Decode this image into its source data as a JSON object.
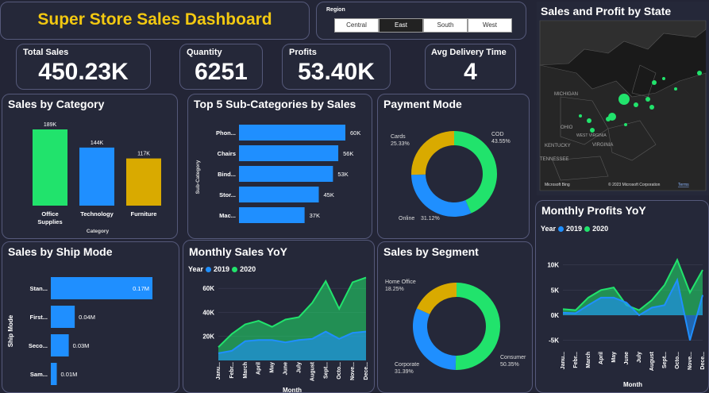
{
  "title": "Super Store Sales Dashboard",
  "region": {
    "label": "Region",
    "options": [
      "Central",
      "East",
      "South",
      "West"
    ],
    "selected": "East"
  },
  "kpis": {
    "total_sales": {
      "label": "Total Sales",
      "value": "450.23K"
    },
    "quantity": {
      "label": "Quantity",
      "value": "6251"
    },
    "profits": {
      "label": "Profits",
      "value": "53.40K"
    },
    "delivery": {
      "label": "Avg Delivery Time",
      "value": "4"
    }
  },
  "map": {
    "title": "Sales and Profit by State",
    "labels": [
      "MICHIGAN",
      "OHIO",
      "KENTUCKY",
      "TENNESSEE",
      "VIRGINIA",
      "WEST VIRGINIA",
      "Microsoft Bing",
      "© 2023 Microsoft Corporation",
      "Terms"
    ]
  },
  "colors": {
    "green": "#21e36c",
    "blue": "#1f8fff",
    "yellow": "#d9aa00",
    "bg": "#232536",
    "card": "#252839"
  },
  "chart_data": [
    {
      "id": "sales_by_category",
      "type": "bar",
      "title": "Sales by Category",
      "xlabel": "Category",
      "categories": [
        "Office Supplies",
        "Technology",
        "Furniture"
      ],
      "values": [
        189,
        144,
        117
      ],
      "labels": [
        "189K",
        "144K",
        "117K"
      ],
      "colors": [
        "#21e36c",
        "#1f8fff",
        "#d9aa00"
      ],
      "ylim": [
        0,
        189
      ]
    },
    {
      "id": "top5_subcategories",
      "type": "bar",
      "orientation": "horizontal",
      "title": "Top 5 Sub-Categories by Sales",
      "ylabel": "Sub-Category",
      "categories": [
        "Phon...",
        "Chairs",
        "Bind...",
        "Stor...",
        "Mac..."
      ],
      "values": [
        60,
        56,
        53,
        45,
        37
      ],
      "labels": [
        "60K",
        "56K",
        "53K",
        "45K",
        "37K"
      ]
    },
    {
      "id": "payment_mode",
      "type": "pie",
      "title": "Payment Mode",
      "slices": [
        {
          "name": "COD",
          "value": 43.55,
          "label": "43.55%",
          "color": "#21e36c"
        },
        {
          "name": "Online",
          "value": 31.12,
          "label": "31.12%",
          "color": "#1f8fff"
        },
        {
          "name": "Cards",
          "value": 25.33,
          "label": "25.33%",
          "color": "#d9aa00"
        }
      ]
    },
    {
      "id": "sales_by_ship_mode",
      "type": "bar",
      "orientation": "horizontal",
      "title": "Sales by Ship Mode",
      "ylabel": "Ship Mode",
      "categories": [
        "Stan...",
        "First...",
        "Seco...",
        "Sam..."
      ],
      "values": [
        0.17,
        0.04,
        0.03,
        0.01
      ],
      "labels": [
        "0.17M",
        "0.04M",
        "0.03M",
        "0.01M"
      ]
    },
    {
      "id": "monthly_sales_yoy",
      "type": "area",
      "title": "Monthly Sales YoY",
      "legend_title": "Year",
      "xlabel": "Month",
      "categories": [
        "Janu...",
        "Febr...",
        "March",
        "April",
        "May",
        "June",
        "July",
        "August",
        "Sept...",
        "Octo...",
        "Nove...",
        "Dece..."
      ],
      "yticks": [
        "20K",
        "40K",
        "60K"
      ],
      "ylim": [
        0,
        70
      ],
      "series": [
        {
          "name": "2020",
          "color": "#21e36c",
          "values": [
            11,
            22,
            30,
            33,
            28,
            34,
            36,
            48,
            66,
            43,
            65,
            69
          ]
        },
        {
          "name": "2019",
          "color": "#1f8fff",
          "values": [
            6,
            8,
            16,
            17,
            17,
            15,
            17,
            18,
            24,
            18,
            23,
            24
          ]
        }
      ]
    },
    {
      "id": "sales_by_segment",
      "type": "pie",
      "title": "Sales by Segment",
      "slices": [
        {
          "name": "Consumer",
          "value": 50.35,
          "label": "50.35%",
          "color": "#21e36c"
        },
        {
          "name": "Corporate",
          "value": 31.39,
          "label": "31.39%",
          "color": "#1f8fff"
        },
        {
          "name": "Home Office",
          "value": 18.25,
          "label": "18.25%",
          "color": "#d9aa00"
        }
      ]
    },
    {
      "id": "monthly_profits_yoy",
      "type": "area",
      "title": "Monthly Profits YoY",
      "legend_title": "Year",
      "xlabel": "Month",
      "categories": [
        "Janu...",
        "Febr...",
        "March",
        "April",
        "May",
        "June",
        "July",
        "August",
        "Sept...",
        "Octo...",
        "Nove...",
        "Dece..."
      ],
      "yticks": [
        "-5K",
        "0K",
        "5K",
        "10K"
      ],
      "ylim": [
        -6,
        12
      ],
      "series": [
        {
          "name": "2020",
          "color": "#21e36c",
          "values": [
            1.2,
            1.0,
            3.5,
            5.0,
            5.5,
            2.0,
            1.0,
            3.0,
            6.0,
            11.0,
            4.5,
            9.0
          ]
        },
        {
          "name": "2019",
          "color": "#1f8fff",
          "values": [
            0.5,
            0.4,
            2.0,
            3.5,
            3.5,
            2.5,
            0.0,
            1.5,
            2.0,
            7.0,
            -5.0,
            4.0
          ]
        }
      ]
    }
  ]
}
